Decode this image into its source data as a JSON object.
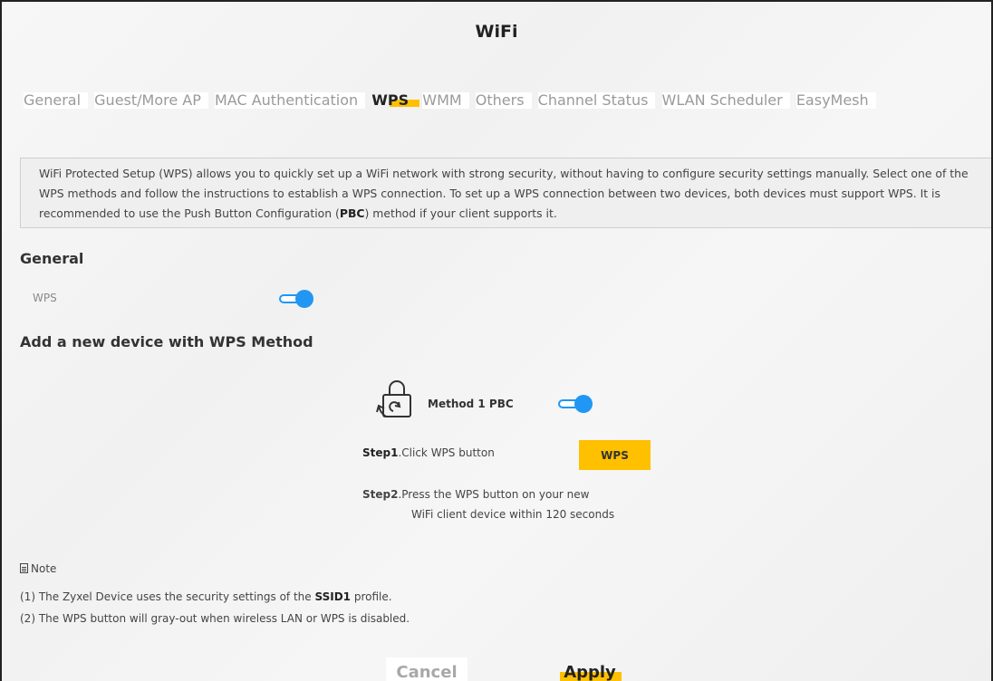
{
  "page": {
    "title": "WiFi"
  },
  "tabs": [
    {
      "label": "General",
      "active": false
    },
    {
      "label": "Guest/More AP",
      "active": false
    },
    {
      "label": "MAC Authentication",
      "active": false
    },
    {
      "label": "WPS",
      "active": true
    },
    {
      "label": "WMM",
      "active": false
    },
    {
      "label": "Others",
      "active": false
    },
    {
      "label": "Channel Status",
      "active": false
    },
    {
      "label": "WLAN Scheduler",
      "active": false
    },
    {
      "label": "EasyMesh",
      "active": false
    }
  ],
  "description": {
    "text_before_bold": "WiFi Protected Setup (WPS) allows you to quickly set up a WiFi network with strong security, without having to configure security settings manually. Select one of the WPS methods and follow the instructions to establish a WPS connection. To set up a WPS connection between two devices, both devices must support WPS. It is recommended to use the Push Button Configuration (",
    "bold": "PBC",
    "text_after_bold": ") method if your client supports it."
  },
  "general": {
    "heading": "General",
    "wps_label": "WPS",
    "wps_enabled": true
  },
  "add_device": {
    "heading": "Add a new device with WPS Method",
    "method_label": "Method 1 PBC",
    "method_enabled": true,
    "step1_bold": "Step1",
    "step1_text": ".Click WPS button",
    "wps_button_label": "WPS",
    "step2_bold": "Step2",
    "step2_text": ".Press the WPS button on your new",
    "step2_text_cont": "WiFi client device within 120 seconds"
  },
  "note": {
    "heading": "Note",
    "line1_prefix": "(1) The Zyxel Device uses the security settings of the ",
    "line1_bold": "SSID1",
    "line1_suffix": " profile.",
    "line2": "(2) The WPS button will gray-out when wireless LAN or WPS is disabled."
  },
  "actions": {
    "cancel_label": "Cancel",
    "apply_label": "Apply"
  },
  "colors": {
    "accent": "#ffc000",
    "toggle": "#2196f3"
  },
  "icons": {
    "method": "lock-icon",
    "note": "note-icon"
  }
}
